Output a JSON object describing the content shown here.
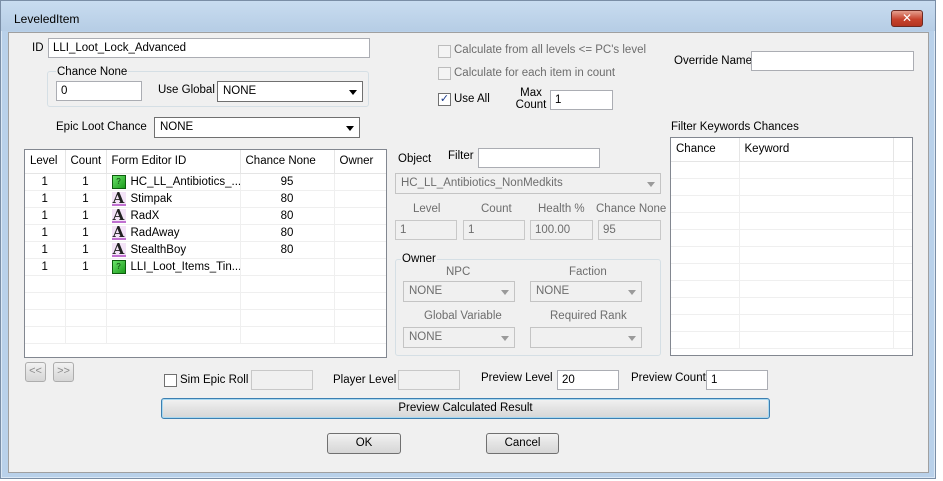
{
  "window": {
    "title": "LeveledItem",
    "close": "✕"
  },
  "id": {
    "label": "ID",
    "value": "LLI_Loot_Lock_Advanced"
  },
  "chance_none": {
    "label": "Chance None",
    "value": "0",
    "use_global_label": "Use Global",
    "use_global_value": "NONE"
  },
  "epic_loot": {
    "label": "Epic Loot Chance",
    "value": "NONE"
  },
  "options": {
    "calc_all_levels": "Calculate from all levels <= PC's level",
    "calc_each_item": "Calculate for each item in count",
    "use_all": "Use All",
    "use_all_checked": "✓",
    "max_count_label": "Max\nCount",
    "max_count_value": "1"
  },
  "override_name": {
    "label": "Override Name",
    "value": ""
  },
  "list": {
    "headers": [
      "Level",
      "Count",
      "Form Editor ID",
      "Chance None",
      "Owner"
    ],
    "rows": [
      {
        "level": "1",
        "count": "1",
        "icon": "leveled-list-icon",
        "glyph": "?",
        "id": "HC_LL_Antibiotics_...",
        "chance": "95",
        "owner": ""
      },
      {
        "level": "1",
        "count": "1",
        "icon": "item-letter-icon",
        "glyph": "A",
        "id": "Stimpak",
        "chance": "80",
        "owner": ""
      },
      {
        "level": "1",
        "count": "1",
        "icon": "item-letter-icon",
        "glyph": "A",
        "id": "RadX",
        "chance": "80",
        "owner": ""
      },
      {
        "level": "1",
        "count": "1",
        "icon": "item-letter-icon",
        "glyph": "A",
        "id": "RadAway",
        "chance": "80",
        "owner": ""
      },
      {
        "level": "1",
        "count": "1",
        "icon": "item-letter-icon",
        "glyph": "A",
        "id": "StealthBoy",
        "chance": "80",
        "owner": ""
      },
      {
        "level": "1",
        "count": "1",
        "icon": "leveled-list-icon",
        "glyph": "?",
        "id": "LLI_Loot_Items_Tin...",
        "chance": "",
        "owner": ""
      }
    ]
  },
  "nav": {
    "prev": "<<",
    "next": ">>"
  },
  "object": {
    "label": "Object",
    "filter_label": "Filter",
    "filter_value": "",
    "value": "HC_LL_Antibiotics_NonMedkits",
    "level_label": "Level",
    "level_value": "1",
    "count_label": "Count",
    "count_value": "1",
    "health_label": "Health %",
    "health_value": "100.00",
    "chance_label": "Chance None",
    "chance_value": "95"
  },
  "owner": {
    "group_label": "Owner",
    "npc_label": "NPC",
    "npc_value": "NONE",
    "faction_label": "Faction",
    "faction_value": "NONE",
    "global_label": "Global Variable",
    "global_value": "NONE",
    "rank_label": "Required Rank",
    "rank_value": ""
  },
  "filter_keywords": {
    "label": "Filter Keywords Chances",
    "headers": [
      "Chance",
      "Keyword"
    ]
  },
  "preview": {
    "sim_epic_label": "Sim Epic Roll",
    "sim_epic_value": "",
    "player_level_label": "Player Level",
    "player_level_value": "",
    "preview_level_label": "Preview Level",
    "preview_level_value": "20",
    "preview_count_label": "Preview Count",
    "preview_count_value": "1",
    "calc_button": "Preview Calculated Result"
  },
  "buttons": {
    "ok": "OK",
    "cancel": "Cancel"
  }
}
